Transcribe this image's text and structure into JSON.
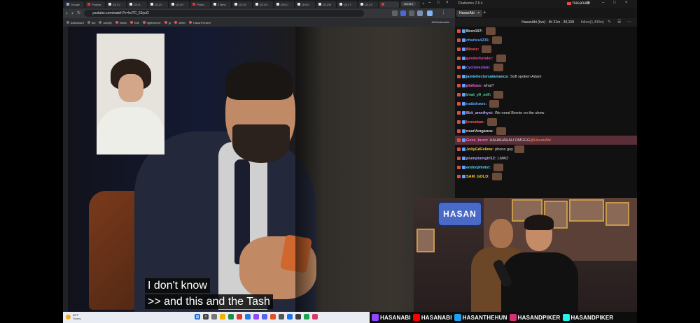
{
  "browser": {
    "tabs": [
      {
        "label": "Google",
        "icon": "google",
        "active": false
      },
      {
        "label": "Podcas",
        "icon": "yt",
        "active": false
      },
      {
        "label": "(21) V",
        "icon": "x",
        "active": false
      },
      {
        "label": "(21) L",
        "icon": "x",
        "active": false
      },
      {
        "label": "(21) h",
        "icon": "x",
        "active": false
      },
      {
        "label": "(21) H",
        "icon": "x",
        "active": false
      },
      {
        "label": "Produ",
        "icon": "yt",
        "active": false
      },
      {
        "label": "2 New",
        "icon": "x",
        "active": false
      },
      {
        "label": "(21) K",
        "icon": "x",
        "active": false
      },
      {
        "label": "(21) N",
        "icon": "x",
        "active": false
      },
      {
        "label": "(20) C",
        "icon": "x",
        "active": false
      },
      {
        "label": "(19) b",
        "icon": "x",
        "active": false
      },
      {
        "label": "(21) W",
        "icon": "x",
        "active": false
      },
      {
        "label": "(21) T",
        "icon": "x",
        "active": false
      },
      {
        "label": "(21) S",
        "icon": "x",
        "active": false
      },
      {
        "label": "",
        "icon": "yt",
        "active": true
      },
      {
        "label": "(21) G",
        "icon": "x",
        "active": false
      }
    ],
    "gemini_label": "Gemini",
    "url": "youtube.com/watch?v=hxTC_5JrjuG",
    "bookmarks": [
      "dashboard",
      "top",
      "activity",
      "News",
      "Edit",
      "rightheener",
      "gr",
      "kieler",
      "HasanFreezer"
    ],
    "all_bookmarks_label": "All Bookmarks"
  },
  "video": {
    "captions": [
      "I don't know",
      ">> and this and the Tash"
    ]
  },
  "taskbar": {
    "weather_temp": "66°F",
    "weather_desc": "Sunny"
  },
  "chatterino": {
    "app_title": "Chatterino 2.5.4",
    "account": "hasanabi",
    "tab_label": "HasanAbi",
    "stream_info": "HasanAbi (live) - 4h 21m - 30,158",
    "follow_info": "follow(1,440m)",
    "messages": [
      {
        "user": "Bren197",
        "color": "#d8d8d8",
        "text": "",
        "emote": true
      },
      {
        "user": "charles4235",
        "color": "#5fa2ff",
        "text": "",
        "emote": true
      },
      {
        "user": "Bloxie",
        "color": "#ff5c5c",
        "text": "",
        "emote": true
      },
      {
        "user": "genderbender",
        "color": "#ff3ea5",
        "text": "",
        "emote": true
      },
      {
        "user": "cyclonezlate",
        "color": "#b05cff",
        "text": "",
        "emote": true
      },
      {
        "user": "jamiehectorsalamanca",
        "color": "#5cd6ff",
        "text": "Soft spoken Adam",
        "emote": false
      },
      {
        "user": "plotluss",
        "color": "#ff6ee0",
        "text": "what?",
        "emote": false
      },
      {
        "user": "treat_y0_self",
        "color": "#4fd4a8",
        "text": "",
        "emote": true
      },
      {
        "user": "natbdraws",
        "color": "#5fa2ff",
        "text": "",
        "emote": true
      },
      {
        "user": "8bit_amethyst",
        "color": "#b9a6ff",
        "text": "We need Bernie on the show",
        "emote": false
      },
      {
        "user": "lonnahan",
        "color": "#ff5c5c",
        "text": "",
        "emote": true
      },
      {
        "user": "nearVenganza",
        "color": "#d8d8d8",
        "text": "",
        "emote": true
      },
      {
        "user": "Genz_bucn",
        "color": "#ff6ee0",
        "text": "HAHAHAHAH OMGGG ",
        "mention": "@HasanAbi",
        "emote": false,
        "highlight": true
      },
      {
        "user": "JollyGdFellow",
        "color": "#ffc83a",
        "text": "phone guy",
        "emote": true
      },
      {
        "user": "plumplumgirl12",
        "color": "#b9a6ff",
        "text": "LMAO",
        "emote": false
      },
      {
        "user": "endorphinist",
        "color": "#5cd6ff",
        "text": "",
        "emote": true
      },
      {
        "user": "SAM_GOLD",
        "color": "#ffc83a",
        "text": "",
        "emote": true
      }
    ]
  },
  "cam": {
    "logo_text": "HASAN"
  },
  "social": [
    {
      "label": "HASANABI",
      "icon": "twitch-icon",
      "color": "#9146ff"
    },
    {
      "label": "HASANABI",
      "icon": "youtube-icon",
      "color": "#ff0000"
    },
    {
      "label": "HASANTHEHUN",
      "icon": "twitter-icon",
      "color": "#1da1f2"
    },
    {
      "label": "HASANDPIKER",
      "icon": "instagram-icon",
      "color": "#d6307a"
    },
    {
      "label": "HASANDPIKER",
      "icon": "tiktok-icon",
      "color": "#25f4ee"
    }
  ]
}
